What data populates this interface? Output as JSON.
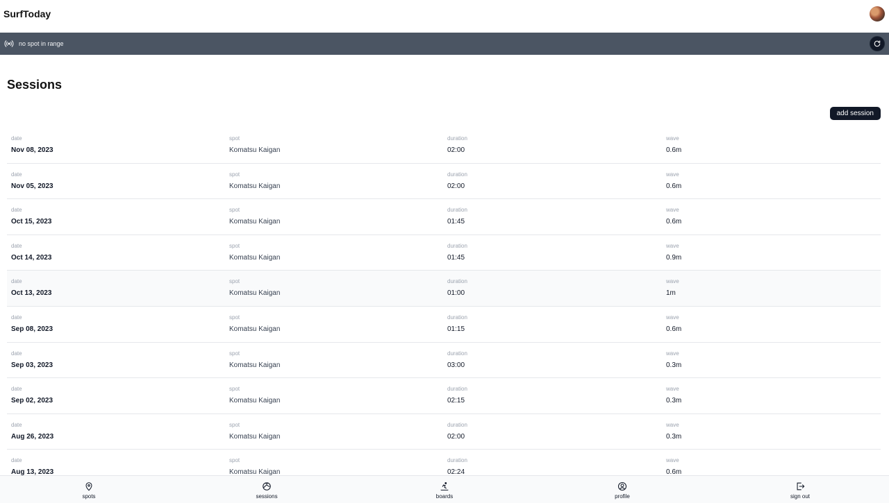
{
  "header": {
    "brand": "SurfToday"
  },
  "statusbar": {
    "text": "no spot in range"
  },
  "main": {
    "title": "Sessions",
    "add_label": "add session",
    "columns": {
      "date": "date",
      "spot": "spot",
      "duration": "duration",
      "wave": "wave"
    },
    "sessions": [
      {
        "date": "Nov 08, 2023",
        "spot": "Komatsu Kaigan",
        "duration": "02:00",
        "wave": "0.6m"
      },
      {
        "date": "Nov 05, 2023",
        "spot": "Komatsu Kaigan",
        "duration": "02:00",
        "wave": "0.6m"
      },
      {
        "date": "Oct 15, 2023",
        "spot": "Komatsu Kaigan",
        "duration": "01:45",
        "wave": "0.6m"
      },
      {
        "date": "Oct 14, 2023",
        "spot": "Komatsu Kaigan",
        "duration": "01:45",
        "wave": "0.9m"
      },
      {
        "date": "Oct 13, 2023",
        "spot": "Komatsu Kaigan",
        "duration": "01:00",
        "wave": "1m"
      },
      {
        "date": "Sep 08, 2023",
        "spot": "Komatsu Kaigan",
        "duration": "01:15",
        "wave": "0.6m"
      },
      {
        "date": "Sep 03, 2023",
        "spot": "Komatsu Kaigan",
        "duration": "03:00",
        "wave": "0.3m"
      },
      {
        "date": "Sep 02, 2023",
        "spot": "Komatsu Kaigan",
        "duration": "02:15",
        "wave": "0.3m"
      },
      {
        "date": "Aug 26, 2023",
        "spot": "Komatsu Kaigan",
        "duration": "02:00",
        "wave": "0.3m"
      },
      {
        "date": "Aug 13, 2023",
        "spot": "Komatsu Kaigan",
        "duration": "02:24",
        "wave": "0.6m"
      }
    ]
  },
  "nav": {
    "items": [
      {
        "label": "spots",
        "icon": "map-pin-icon"
      },
      {
        "label": "sessions",
        "icon": "sessions-icon"
      },
      {
        "label": "boards",
        "icon": "surfboard-icon"
      },
      {
        "label": "profile",
        "icon": "profile-icon"
      },
      {
        "label": "sign out",
        "icon": "sign-out-icon"
      }
    ]
  },
  "colors": {
    "statusbar": "#4b5563",
    "button": "#111827"
  }
}
